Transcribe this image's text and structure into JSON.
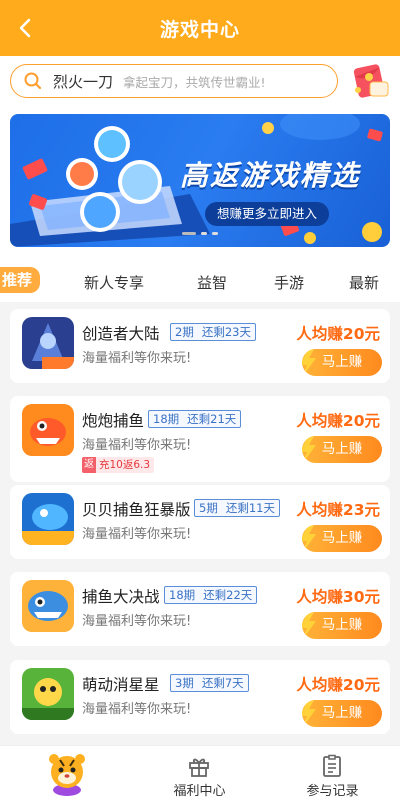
{
  "header": {
    "title": "游戏中心",
    "back_icon": "chevron-left-icon",
    "color": "#ffab1c"
  },
  "search": {
    "icon": "search-icon",
    "keyword": "烈火一刀",
    "hint": "拿起宝刀，共筑传世霸业!"
  },
  "banner": {
    "title": "高返游戏精选",
    "subtitle": "想赚更多立即进入"
  },
  "tabs": {
    "items": [
      "推荐",
      "新人专享",
      "益智",
      "手游",
      "最新"
    ],
    "active": "推荐"
  },
  "games": [
    {
      "name": "创造者大陆",
      "period": "2期",
      "remaining": "还剩23天",
      "desc": "海量福利等你来玩!",
      "earn": "人均赚20元",
      "button": "马上赚",
      "rebate": ""
    },
    {
      "name": "炮炮捕鱼",
      "period": "18期",
      "remaining": "还剩21天",
      "desc": "海量福利等你来玩!",
      "earn": "人均赚20元",
      "button": "马上赚",
      "rebate_mark": "返",
      "rebate": "充10返6.3"
    },
    {
      "name": "贝贝捕鱼狂暴版",
      "period": "5期",
      "remaining": "还剩11天",
      "desc": "海量福利等你来玩!",
      "earn": "人均赚23元",
      "button": "马上赚",
      "rebate": ""
    },
    {
      "name": "捕鱼大决战",
      "period": "18期",
      "remaining": "还剩22天",
      "desc": "海量福利等你来玩!",
      "earn": "人均赚30元",
      "button": "马上赚",
      "rebate": ""
    },
    {
      "name": "萌动消星星",
      "period": "3期",
      "remaining": "还剩7天",
      "desc": "海量福利等你来玩!",
      "earn": "人均赚20元",
      "button": "马上赚",
      "rebate": ""
    }
  ],
  "bottom_nav": [
    {
      "label": "",
      "icon": "tiger-mascot-icon"
    },
    {
      "label": "福利中心",
      "icon": "gift-icon"
    },
    {
      "label": "参与记录",
      "icon": "clipboard-icon"
    }
  ],
  "colors": {
    "accent": "#ffab1c",
    "earn": "#ff6a13",
    "period_border": "#5a8fd8"
  }
}
